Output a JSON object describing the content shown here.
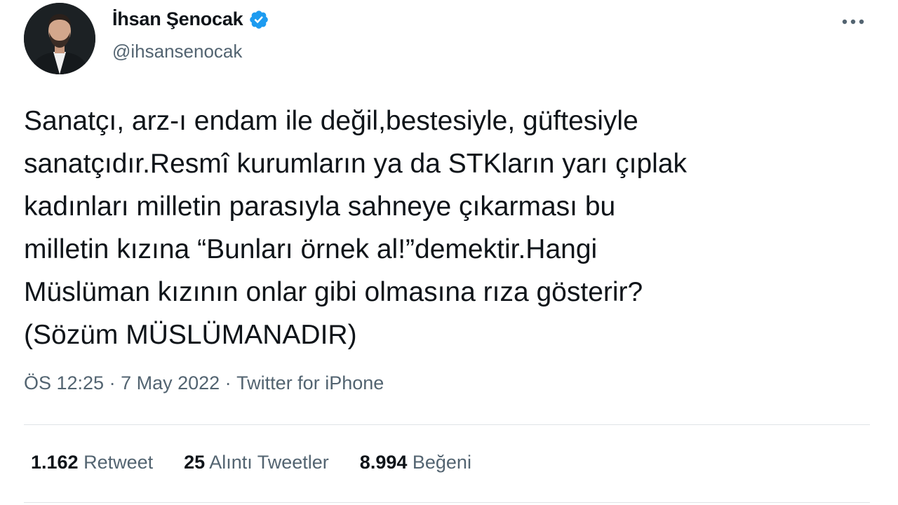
{
  "author": {
    "display_name": "İhsan Şenocak",
    "handle": "@ihsansenocak",
    "verified_icon": "verified-badge-icon",
    "avatar_icon": "profile-avatar"
  },
  "tweet": {
    "text": "Sanatçı, arz-ı endam ile değil,bestesiyle, güftesiyle\nsanatçıdır.Resmî kurumların ya da STKların yarı çıplak\nkadınları milletin parasıyla sahneye çıkarması bu\nmilletin kızına “Bunları örnek al!”demektir.Hangi\nMüslüman kızının onlar gibi olmasına rıza gösterir?\n(Sözüm MÜSLÜMANADIR)",
    "time": "ÖS 12:25",
    "separator1": " · ",
    "date": "7 May 2022",
    "separator2": " · ",
    "source": "Twitter for iPhone"
  },
  "stats": {
    "retweets_count": "1.162",
    "retweets_label": " Retweet",
    "quotes_count": "25",
    "quotes_label": " Alıntı Tweetler",
    "likes_count": "8.994",
    "likes_label": " Beğeni"
  },
  "colors": {
    "text": "#0f1419",
    "secondary": "#536471",
    "verified": "#1d9bf0",
    "divider": "#dfe3e6"
  }
}
